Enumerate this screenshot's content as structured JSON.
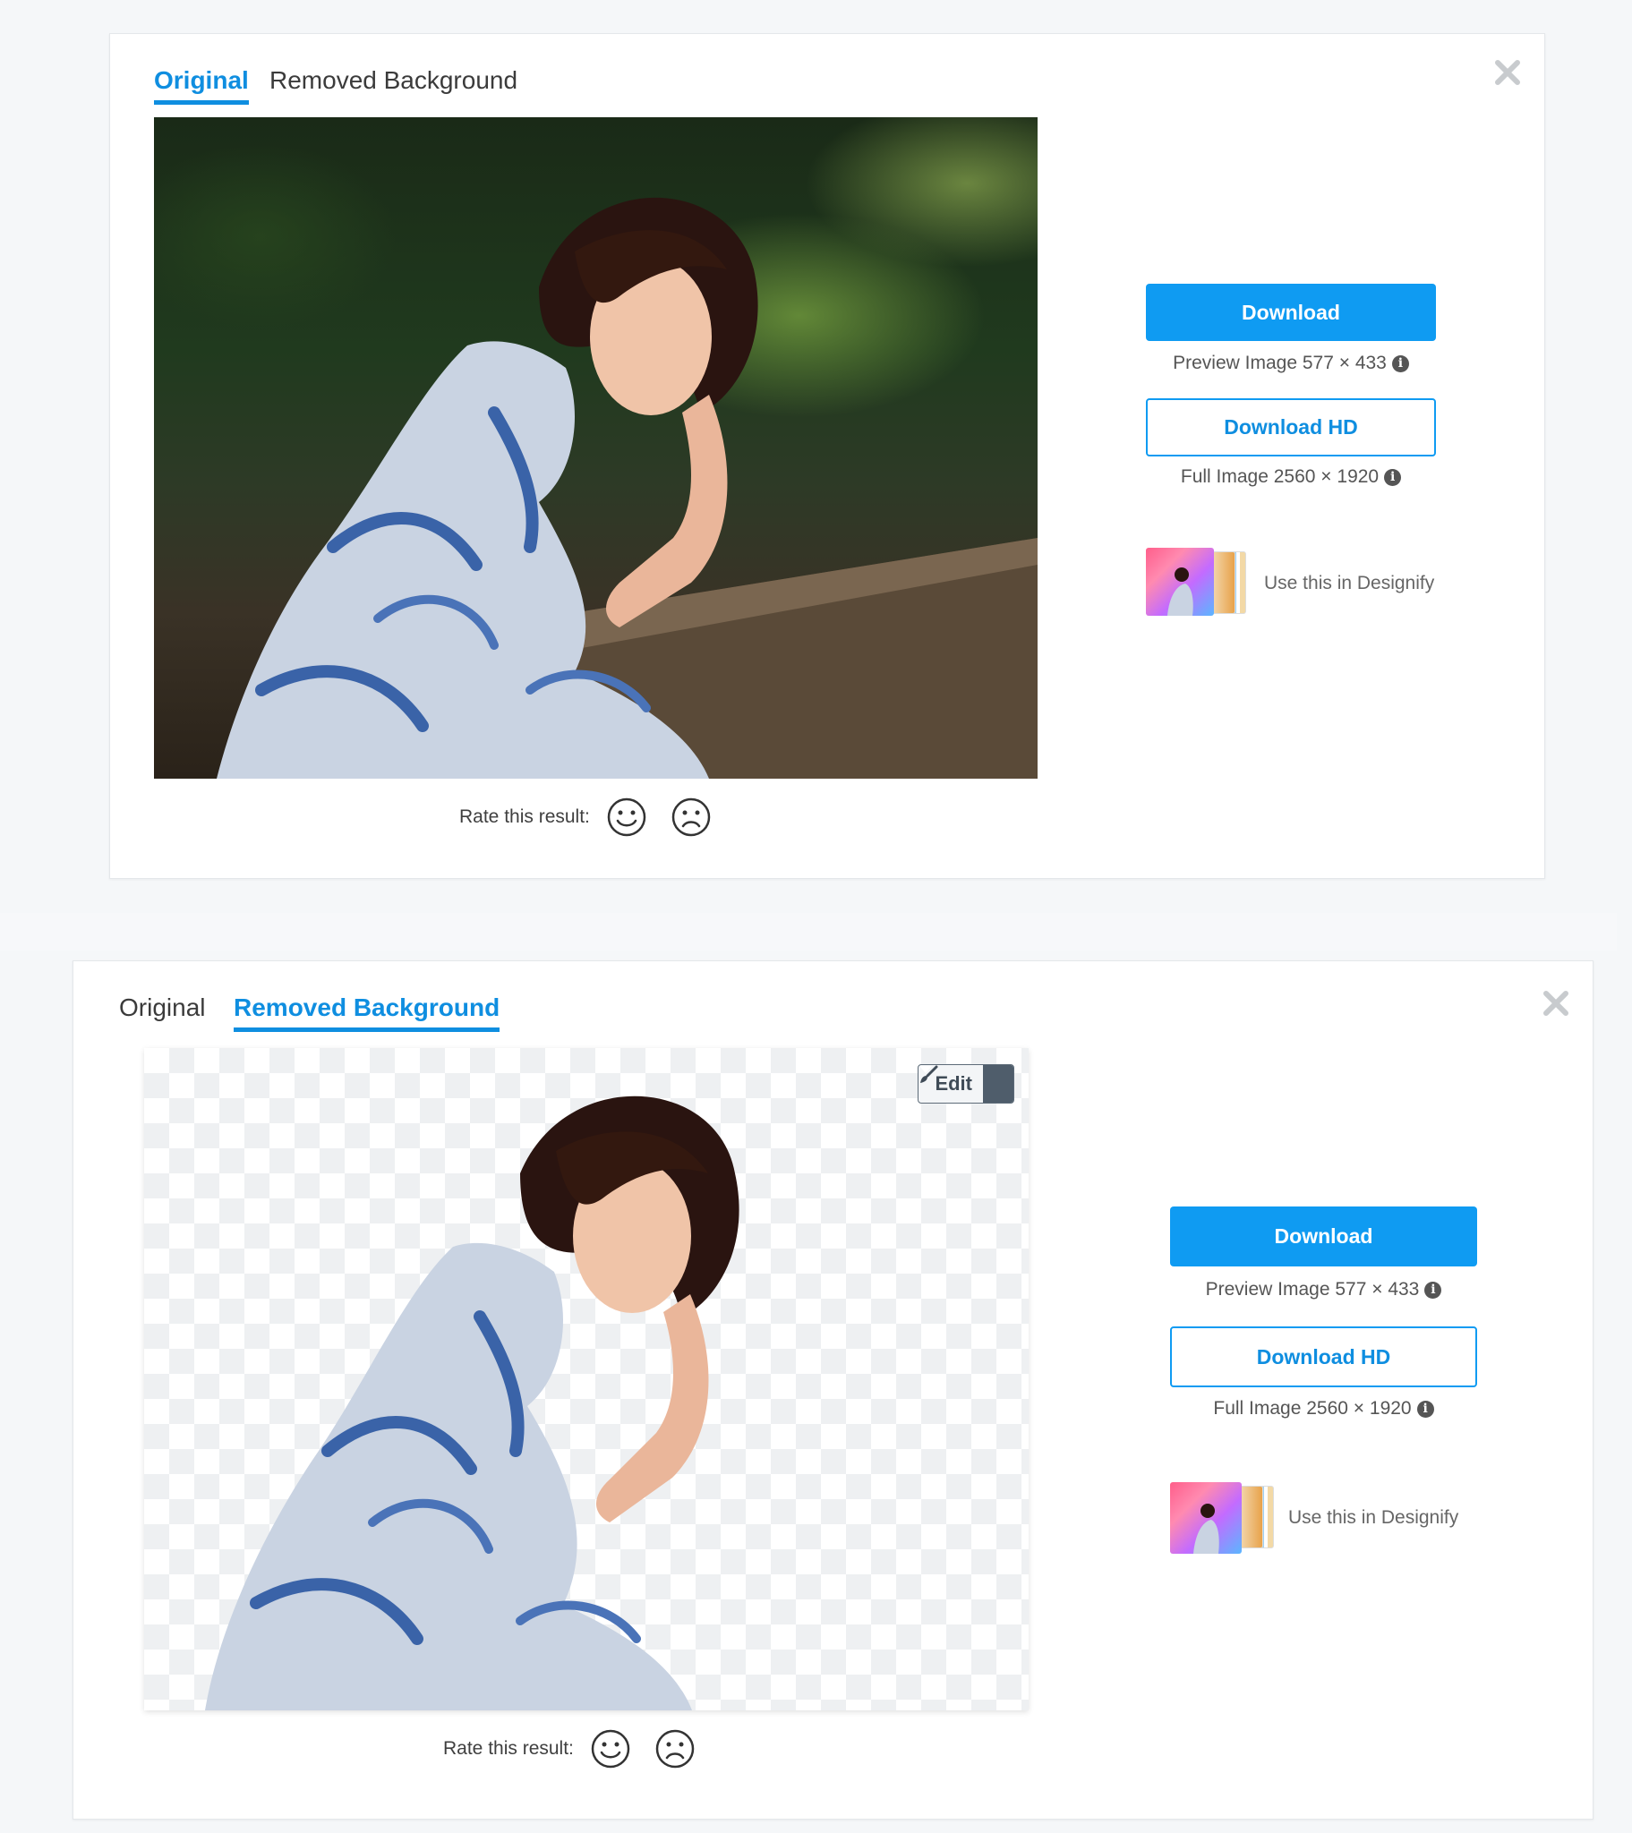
{
  "panels": [
    {
      "tabs": [
        {
          "label": "Original",
          "active": true
        },
        {
          "label": "Removed Background",
          "active": false
        }
      ],
      "image_view": "original",
      "rate_label": "Rate this result:",
      "download_label": "Download",
      "preview_meta": "Preview Image 577 × 433",
      "download_hd_label": "Download HD",
      "full_meta": "Full Image 2560 × 1920",
      "designify_label": "Use this in Designify"
    },
    {
      "tabs": [
        {
          "label": "Original",
          "active": false
        },
        {
          "label": "Removed Background",
          "active": true
        }
      ],
      "image_view": "removed-background",
      "edit_label": "Edit",
      "rate_label": "Rate this result:",
      "download_label": "Download",
      "preview_meta": "Preview Image 577 × 433",
      "download_hd_label": "Download HD",
      "full_meta": "Full Image 2560 × 1920",
      "designify_label": "Use this in Designify"
    }
  ],
  "icons": {
    "close": "close-icon",
    "info": "info-icon",
    "happy": "smiley-face-icon",
    "sad": "frowning-face-icon",
    "brush": "paintbrush-icon",
    "caret": "caret-down-icon"
  },
  "colors": {
    "accent": "#0f9bf2",
    "accent_text": "#0f8ee0",
    "close_icon": "#c8cbce",
    "edit_caret_bg": "#4f5d6b"
  }
}
